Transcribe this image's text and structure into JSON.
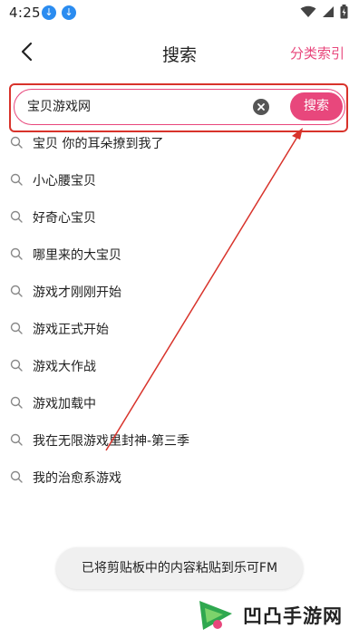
{
  "status_bar": {
    "time": "4:25",
    "icons": [
      "download-icon",
      "download-icon",
      "wifi-icon",
      "signal-icon",
      "battery-icon"
    ]
  },
  "header": {
    "title": "搜索",
    "right_link": "分类索引"
  },
  "search": {
    "value": "宝贝游戏网",
    "button_label": "搜索"
  },
  "suggestions": [
    "宝贝 你的耳朵撩到我了",
    "小心腰宝贝",
    "好奇心宝贝",
    "哪里来的大宝贝",
    "游戏才刚刚开始",
    "游戏正式开始",
    "游戏大作战",
    "游戏加载中",
    "我在无限游戏里封神-第三季",
    "我的治愈系游戏"
  ],
  "toast": "已将剪贴板中的内容粘贴到乐可FM",
  "watermark": "凹凸手游网",
  "colors": {
    "accent": "#e8477c",
    "highlight": "#d8332b"
  }
}
